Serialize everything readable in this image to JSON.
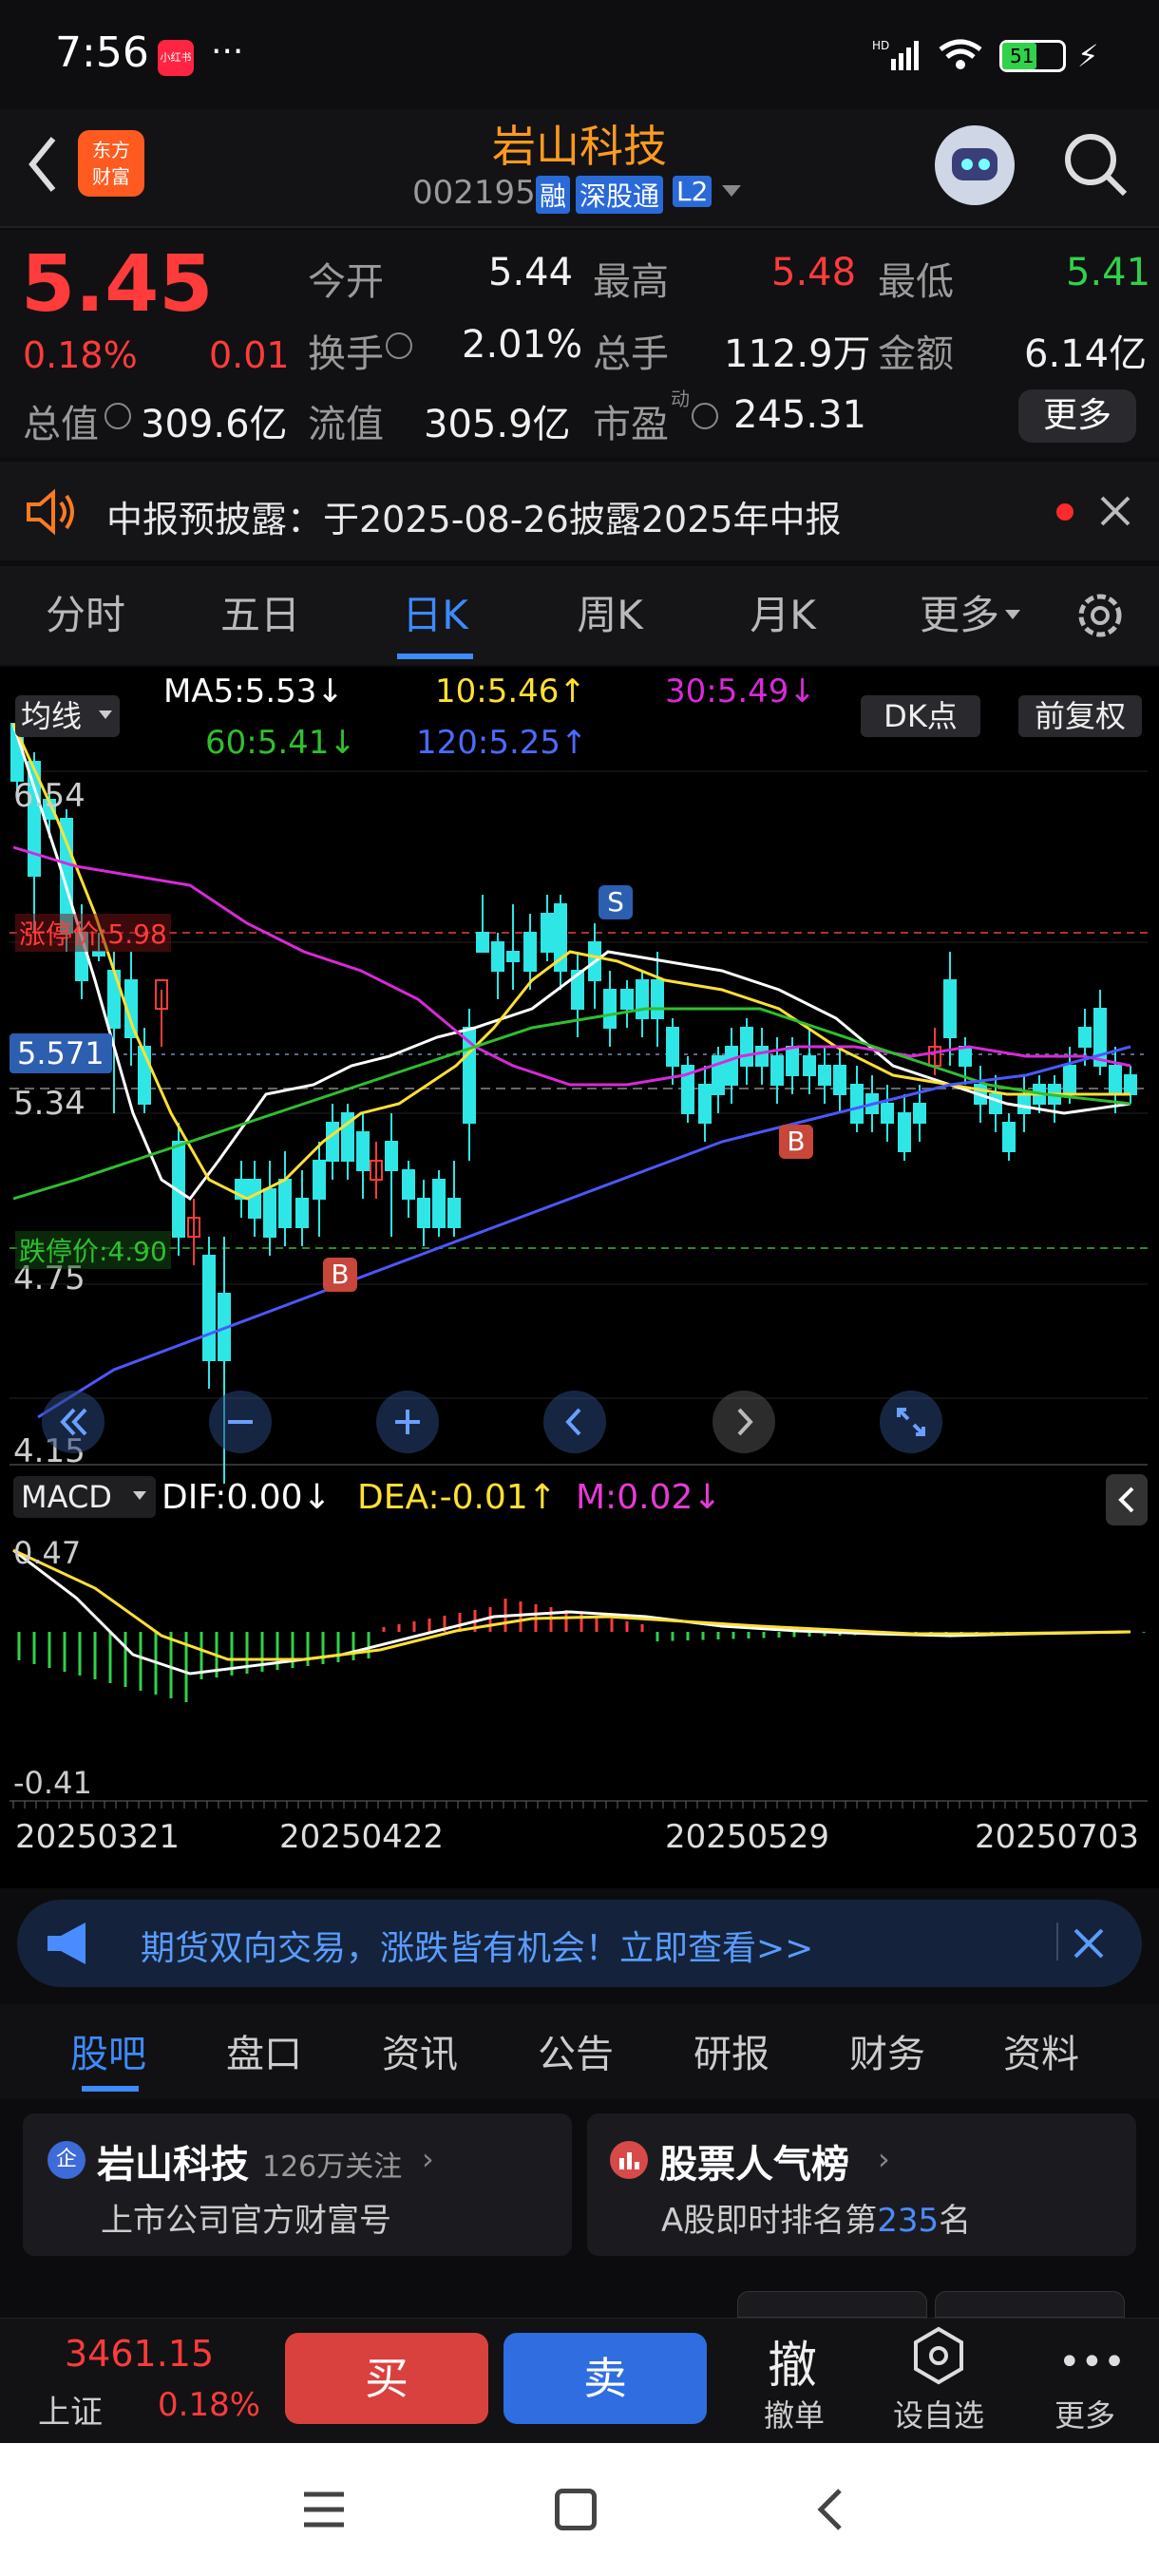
{
  "status": {
    "time": "7:56",
    "app_badge": "小红书",
    "more": "···",
    "battery": "51",
    "signal": "HD"
  },
  "header": {
    "logo_line1": "东方",
    "logo_line2": "财富",
    "title": "岩山科技",
    "code": "002195",
    "tag_rong": "融",
    "tag_sgt": "深股通",
    "tag_l2": "L2"
  },
  "quote": {
    "price": "5.45",
    "pct": "0.18%",
    "chg": "0.01",
    "open_label": "今开",
    "open": "5.44",
    "high_label": "最高",
    "high": "5.48",
    "low_label": "最低",
    "low": "5.41",
    "turnover_label": "换手",
    "turnover": "2.01%",
    "vol_label": "总手",
    "vol": "112.9万",
    "amount_label": "金额",
    "amount": "6.14亿",
    "mcap_label": "总值",
    "mcap": "309.6亿",
    "float_label": "流值",
    "float": "305.9亿",
    "pe_label": "市盈",
    "pe_sup": "动",
    "pe": "245.31",
    "more_btn": "更多"
  },
  "notice": {
    "text": "中报预披露：于2025-08-26披露2025年中报"
  },
  "tabs": [
    "分时",
    "五日",
    "日K",
    "周K",
    "月K",
    "更多"
  ],
  "active_tab": "日K",
  "ma": {
    "selector": "均线",
    "ma5": "MA5:5.53↓",
    "ma10": "10:5.46↑",
    "ma30": "30:5.49↓",
    "ma60": "60:5.41↓",
    "ma120": "120:5.25↑",
    "dk": "DK点",
    "fq": "前复权"
  },
  "kline": {
    "y_top": "6.54",
    "y_mid1": "5.34",
    "y_mid2": "4.75",
    "y_bot": "4.15",
    "limit_up": "涨停价:5.98",
    "limit_down": "跌停价:4.90",
    "cur": "5.571",
    "sell_mark": "S",
    "buy_mark": "B"
  },
  "macd": {
    "selector": "MACD",
    "dif": "DIF:0.00↓",
    "dea": "DEA:-0.01↑",
    "m": "M:0.02↓",
    "y_top": "0.47",
    "y_bot": "-0.41"
  },
  "dates": [
    "20250321",
    "20250422",
    "20250529",
    "20250703"
  ],
  "ad": {
    "text": "期货双向交易，涨跌皆有机会！立即查看>>"
  },
  "subtabs": [
    "股吧",
    "盘口",
    "资讯",
    "公告",
    "研报",
    "财务",
    "资料"
  ],
  "card1": {
    "name": "岩山科技",
    "follow": "126万关注",
    "desc": "上市公司官方财富号"
  },
  "card2": {
    "name": "股票人气榜",
    "desc_pre": "A股即时排名第",
    "rank": "235",
    "desc_post": "名"
  },
  "bottom": {
    "index_val": "3461.15",
    "index_name": "上证",
    "index_pct": "0.18%",
    "buy": "买",
    "sell": "卖",
    "cancel_big": "撤",
    "cancel": "撤单",
    "watch": "设自选",
    "more": "更多"
  },
  "colors": {
    "up": "#ff3b3b",
    "down": "#2ee6e6",
    "ma5": "#ffffff",
    "ma10": "#ffe033",
    "ma30": "#d82ad8",
    "ma60": "#2fbf2f",
    "ma120": "#4b58ff",
    "accent": "#ff8a00"
  }
}
